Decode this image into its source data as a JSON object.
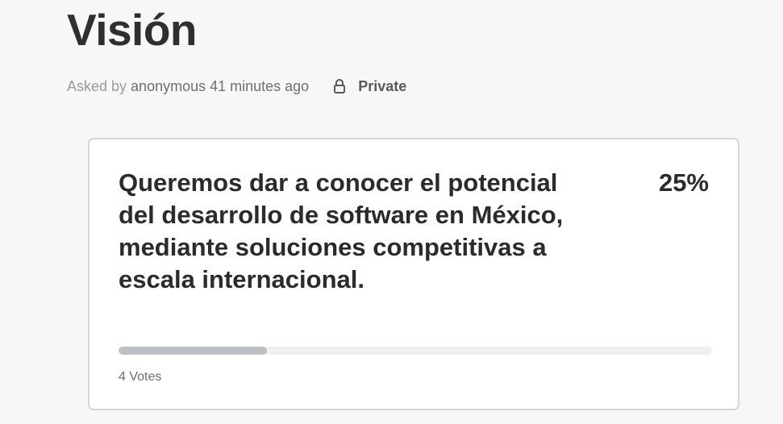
{
  "page": {
    "title": "Visión"
  },
  "meta": {
    "asked_by_label": "Asked by",
    "author": "anonymous",
    "time": "41 minutes ago",
    "privacy_icon": "lock-icon",
    "privacy_label": "Private"
  },
  "poll_option": {
    "text": "Queremos dar a conocer el potencial del desarrollo de software en México, mediante soluciones competitivas a escala internacional.",
    "percent_label": "25%",
    "progress_fraction": 0.25,
    "votes_label": "4 Votes"
  },
  "colors": {
    "background": "#f7f7f7",
    "card_border": "#d6d6d6",
    "progress_fill": "#bdc1c5",
    "progress_track": "#efefef"
  }
}
